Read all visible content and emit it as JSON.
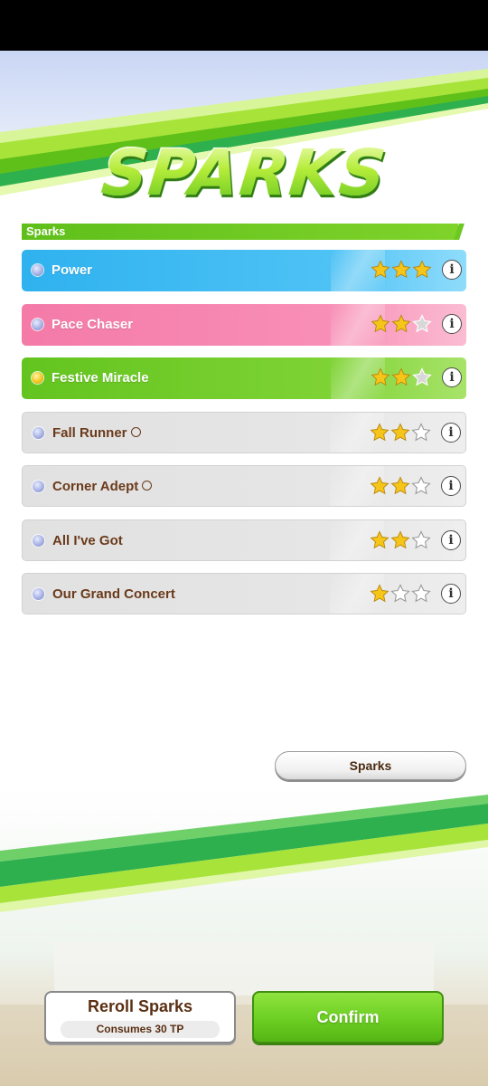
{
  "screen": {
    "title": "SPARKS"
  },
  "section": {
    "header": "Sparks"
  },
  "sparks": [
    {
      "name": "Power",
      "stars": 3,
      "max_stars": 3,
      "style": "blue",
      "orb": "silver",
      "has_ring": false
    },
    {
      "name": "Pace Chaser",
      "stars": 2,
      "max_stars": 3,
      "style": "pink",
      "orb": "silver",
      "has_ring": false
    },
    {
      "name": "Festive Miracle",
      "stars": 2,
      "max_stars": 3,
      "style": "green",
      "orb": "gold",
      "has_ring": false
    },
    {
      "name": "Fall Runner",
      "stars": 2,
      "max_stars": 3,
      "style": "gray",
      "orb": "silver",
      "has_ring": true
    },
    {
      "name": "Corner Adept",
      "stars": 2,
      "max_stars": 3,
      "style": "gray",
      "orb": "silver",
      "has_ring": true
    },
    {
      "name": "All I've Got",
      "stars": 2,
      "max_stars": 3,
      "style": "gray",
      "orb": "silver",
      "has_ring": false
    },
    {
      "name": "Our Grand Concert",
      "stars": 1,
      "max_stars": 3,
      "style": "gray",
      "orb": "silver",
      "has_ring": false
    }
  ],
  "info_glyph": "i",
  "buttons": {
    "sparks_label": "Sparks",
    "reroll_label": "Reroll Sparks",
    "reroll_cost": "Consumes 30 TP",
    "confirm_label": "Confirm"
  },
  "colors": {
    "accent_green": "#6cce22",
    "blue_row": "#2fb2ef",
    "pink_row": "#f47aa8",
    "green_row": "#63c41f",
    "gray_row": "#e1e1e1",
    "star_gold": "#f5c51a",
    "label_brown": "#6b3a1a"
  },
  "icons": {
    "orb": "skill-orb-icon",
    "star": "star-icon",
    "info": "info-icon",
    "ring": "circle-marker-icon"
  }
}
